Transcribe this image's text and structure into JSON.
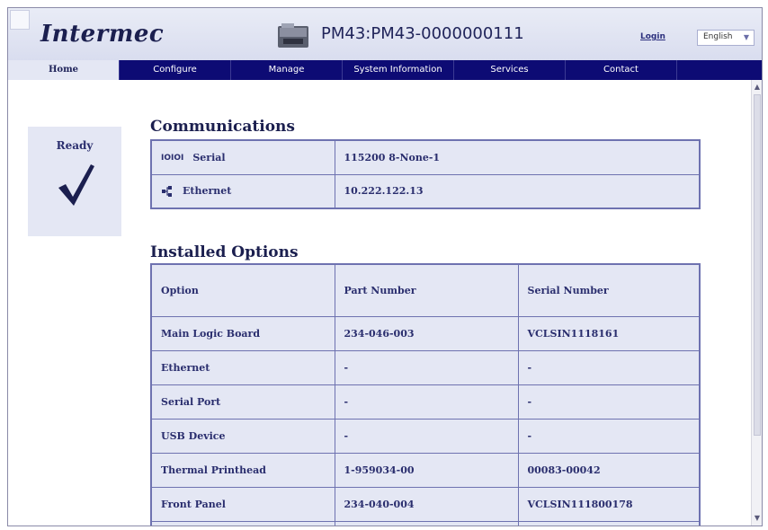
{
  "header": {
    "logo_text": "Intermec",
    "device_title": "PM43:PM43-0000000111",
    "login_label": "Login",
    "language": "English"
  },
  "nav": {
    "items": [
      {
        "label": "Home"
      },
      {
        "label": "Configure"
      },
      {
        "label": "Manage"
      },
      {
        "label": "System Information"
      },
      {
        "label": "Services"
      },
      {
        "label": "Contact"
      }
    ]
  },
  "status": {
    "label": "Ready"
  },
  "communications": {
    "title": "Communications",
    "rows": [
      {
        "icon": "serial-port-icon",
        "name": "Serial",
        "value": "115200 8-None-1"
      },
      {
        "icon": "ethernet-icon",
        "name": "Ethernet",
        "value": "10.222.122.13"
      }
    ]
  },
  "installed_options": {
    "title": "Installed Options",
    "headers": [
      "Option",
      "Part Number",
      "Serial Number"
    ],
    "rows": [
      {
        "option": "Main Logic Board",
        "part": "234-046-003",
        "serial": "VCLSIN1118161"
      },
      {
        "option": "Ethernet",
        "part": "-",
        "serial": "-"
      },
      {
        "option": "Serial Port",
        "part": "-",
        "serial": "-"
      },
      {
        "option": "USB Device",
        "part": "-",
        "serial": "-"
      },
      {
        "option": "Thermal Printhead",
        "part": "1-959034-00",
        "serial": "00083-00042"
      },
      {
        "option": "Front Panel",
        "part": "234-040-004",
        "serial": "VCLSIN111800178"
      }
    ]
  },
  "colors": {
    "nav_bg": "#0d0b74",
    "panel_bg": "#e4e7f4",
    "border": "#6e72b0",
    "text_dark": "#1b1f4f"
  }
}
